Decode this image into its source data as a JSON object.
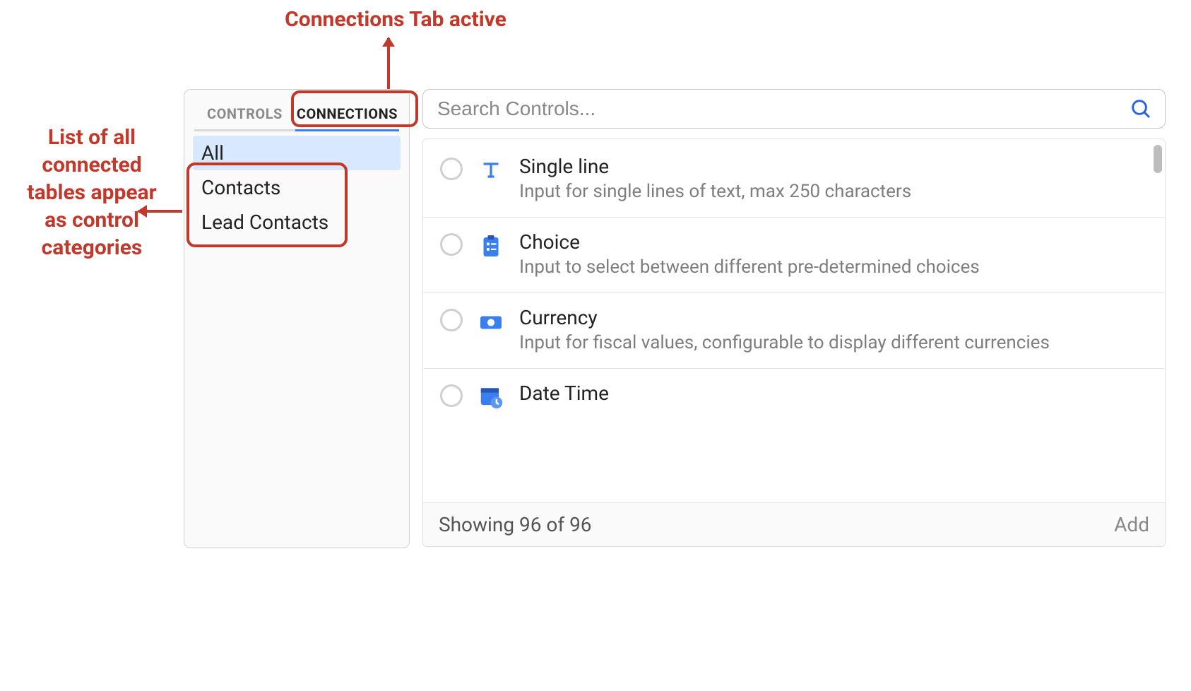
{
  "annotations": {
    "top": "Connections Tab active",
    "left": "List of all connected tables appear as control categories"
  },
  "sidebar": {
    "tabs": [
      {
        "label": "CONTROLS",
        "active": false
      },
      {
        "label": "CONNECTIONS",
        "active": true
      }
    ],
    "categories": [
      {
        "label": "All",
        "selected": true
      },
      {
        "label": "Contacts",
        "selected": false
      },
      {
        "label": "Lead Contacts",
        "selected": false
      }
    ]
  },
  "search": {
    "placeholder": "Search Controls..."
  },
  "controls": [
    {
      "icon": "text-icon",
      "title": "Single line",
      "desc": "Input for single lines of text, max 250 characters"
    },
    {
      "icon": "clipboard-icon",
      "title": "Choice",
      "desc": "Input to select between different pre-determined choices"
    },
    {
      "icon": "currency-icon",
      "title": "Currency",
      "desc": "Input for fiscal values, configurable to display different currencies"
    },
    {
      "icon": "calendar-clock-icon",
      "title": "Date Time",
      "desc": ""
    }
  ],
  "footer": {
    "status": "Showing 96 of 96",
    "add_label": "Add"
  }
}
